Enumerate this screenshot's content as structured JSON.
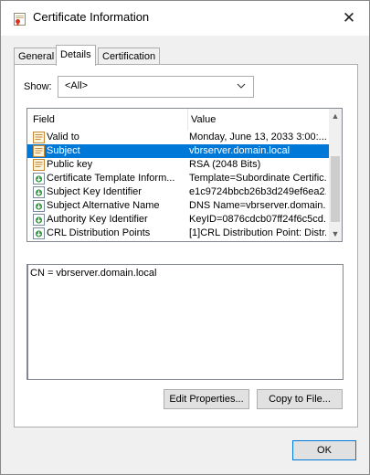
{
  "window": {
    "title": "Certificate Information",
    "close_glyph": "✕"
  },
  "tabs": [
    {
      "label": "General",
      "active": false
    },
    {
      "label": "Details",
      "active": true
    },
    {
      "label": "Certification Path",
      "active": false
    }
  ],
  "show": {
    "label": "Show:",
    "selected": "<All>"
  },
  "list": {
    "columns": {
      "field": "Field",
      "value": "Value"
    },
    "rows": [
      {
        "field": "Valid to",
        "value": "Monday, June 13, 2033 3:00:...",
        "icon": "certificate-field-icon",
        "selected": false
      },
      {
        "field": "Subject",
        "value": "vbrserver.domain.local",
        "icon": "certificate-field-icon",
        "selected": true
      },
      {
        "field": "Public key",
        "value": "RSA (2048 Bits)",
        "icon": "certificate-field-icon",
        "selected": false
      },
      {
        "field": "Certificate Template Inform...",
        "value": "Template=Subordinate Certific...",
        "icon": "extension-icon",
        "selected": false
      },
      {
        "field": "Subject Key Identifier",
        "value": "e1c9724bbcb26b3d249ef6ea2...",
        "icon": "extension-icon",
        "selected": false
      },
      {
        "field": "Subject Alternative Name",
        "value": "DNS Name=vbrserver.domain....",
        "icon": "extension-icon",
        "selected": false
      },
      {
        "field": "Authority Key Identifier",
        "value": "KeyID=0876cdcb07ff24f6c5cd...",
        "icon": "extension-icon",
        "selected": false
      },
      {
        "field": "CRL Distribution Points",
        "value": "[1]CRL Distribution Point: Distr...",
        "icon": "extension-icon",
        "selected": false
      }
    ]
  },
  "detail_text": "CN = vbrserver.domain.local",
  "buttons": {
    "edit_properties": "Edit Properties...",
    "copy_to_file": "Copy to File...",
    "ok": "OK"
  },
  "colors": {
    "selection": "#0078d7",
    "window_bg": "#f0f0f0"
  }
}
